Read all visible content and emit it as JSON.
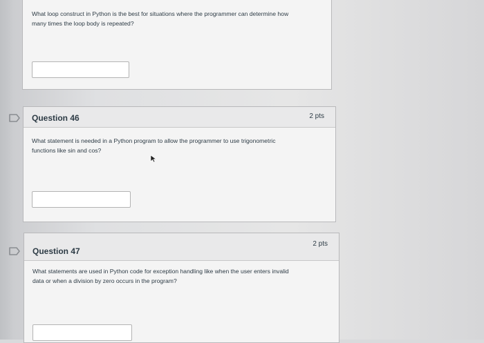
{
  "questions": [
    {
      "text_line1": "What loop construct in Python is the best for situations where the programmer can determine how",
      "text_line2": "many times the loop body is repeated?",
      "answer_value": ""
    },
    {
      "title": "Question 46",
      "points": "2 pts",
      "text_line1": "What statement is needed in a Python program to allow the programmer to use trigonometric",
      "text_line2": "functions like sin and cos?",
      "answer_value": ""
    },
    {
      "title": "Question 47",
      "points": "2 pts",
      "text_line1": "What statements are used in Python code for exception handling like when the user enters invalid",
      "text_line2": "data or when a division by zero occurs in the program?",
      "answer_value": ""
    }
  ],
  "icons": {
    "flag": "flag-icon",
    "cursor": "mouse-cursor-icon"
  }
}
